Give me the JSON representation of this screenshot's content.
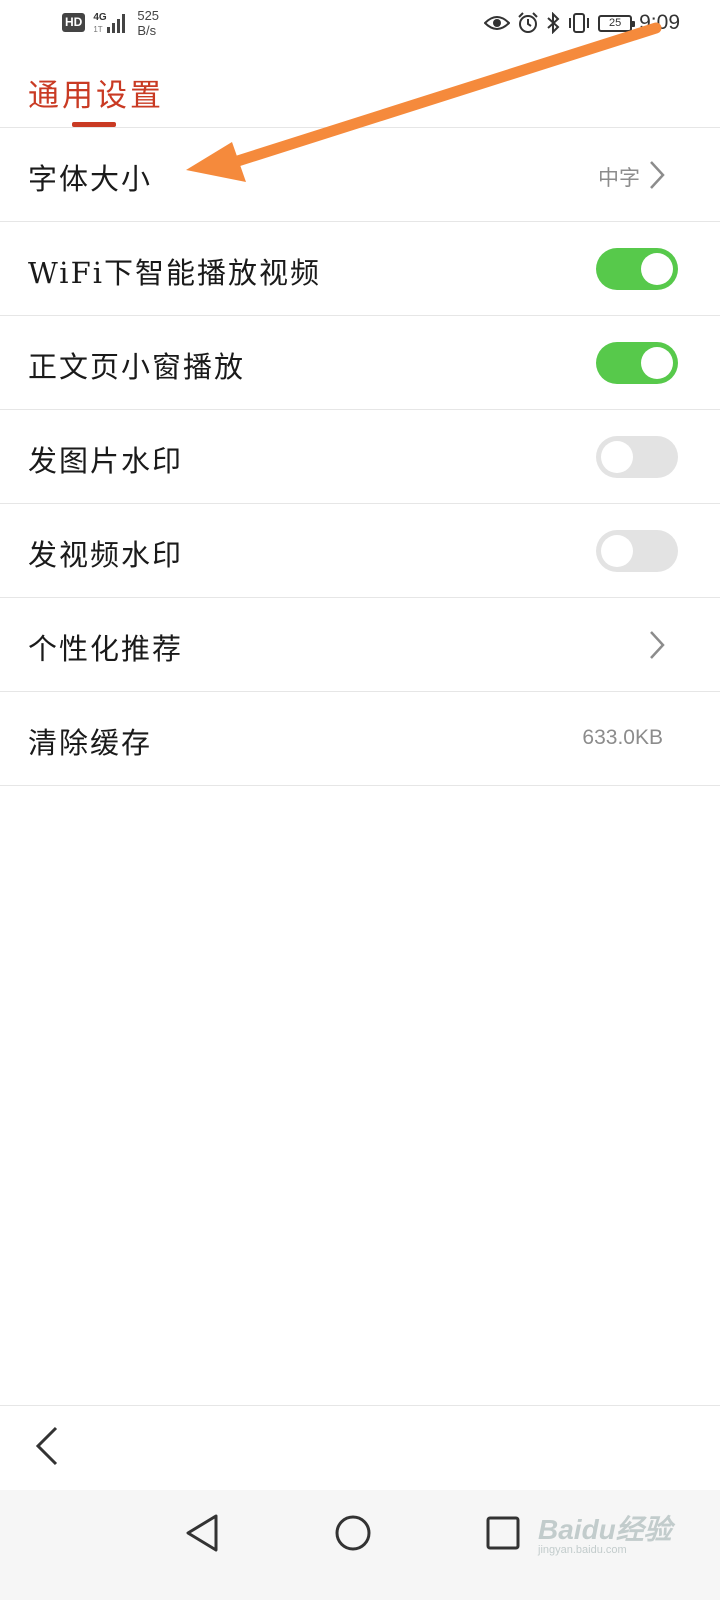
{
  "status_bar": {
    "hd": "HD",
    "network": "4G",
    "network_sub": "1T",
    "speed_value": "525",
    "speed_unit": "B/s",
    "battery": "25",
    "time": "9:09",
    "icons": [
      "eye-icon",
      "alarm-icon",
      "bluetooth-icon",
      "vibrate-icon",
      "battery-icon"
    ]
  },
  "header": {
    "title": "通用设置",
    "accent_color": "#c93a23"
  },
  "settings": {
    "font_size": {
      "label": "字体大小",
      "value": "中字"
    },
    "wifi_autoplay": {
      "label": "WiFi下智能播放视频",
      "enabled": true
    },
    "article_mini_window": {
      "label": "正文页小窗播放",
      "enabled": true
    },
    "image_watermark": {
      "label": "发图片水印",
      "enabled": false
    },
    "video_watermark": {
      "label": "发视频水印",
      "enabled": false
    },
    "personalized_recommend": {
      "label": "个性化推荐"
    },
    "clear_cache": {
      "label": "清除缓存",
      "value": "633.0KB"
    }
  },
  "colors": {
    "toggle_on": "#57c94b",
    "toggle_off": "#e3e3e3",
    "annotation_arrow": "#f58a3c"
  },
  "watermark": {
    "text": "Baidu经验",
    "sub": "jingyan.baidu.com"
  }
}
